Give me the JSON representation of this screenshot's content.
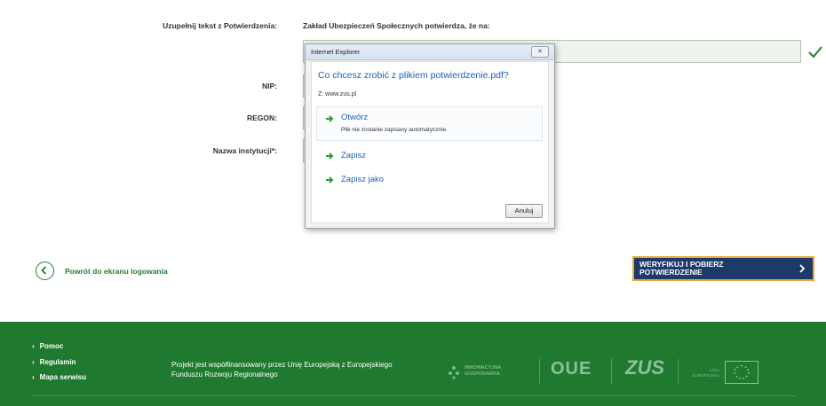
{
  "form": {
    "confirmation_label": "Uzupełnij tekst z Potwierdzenia:",
    "confirmation_text": "Zakład Ubezpieczeń Społecznych potwierdza, że na:",
    "nip_label": "NIP:",
    "regon_label": "REGON:",
    "institution_label": "Nazwa instytucji*:"
  },
  "dialog": {
    "title": "Internet Explorer",
    "close_glyph": "✕",
    "question": "Co chcesz zrobić z plikiem potwierdzenie.pdf?",
    "source": "Z: www.zus.pl",
    "options": [
      {
        "label": "Otwórz",
        "sub": "Plik nie zostanie zapisany automatycznie."
      },
      {
        "label": "Zapisz"
      },
      {
        "label": "Zapisz jako"
      }
    ],
    "cancel_label": "Anuluj"
  },
  "actions": {
    "back_label": "Powrót do ekranu logowania",
    "verify_label": "WERYFIKUJ I POBIERZ POTWIERDZENIE"
  },
  "footer": {
    "links": [
      "Pomoc",
      "Regulamin",
      "Mapa serwisu"
    ],
    "project_text": "Projekt jest współfinansowany przez Unię Europejską z Europejskiego Funduszu Rozwoju Regionalnego",
    "logo_ig_text": "INNOWACYJNA GOSPODARKA",
    "logo_poe": "OUE",
    "logo_zus": "ZUS",
    "logo_eu_text": "UNIA EUROPEJSKA"
  },
  "colors": {
    "footer_green": "#1f7a2f",
    "button_navy": "#1d3a6b",
    "button_border": "#e9a73a",
    "link_blue": "#1f5fb4"
  }
}
